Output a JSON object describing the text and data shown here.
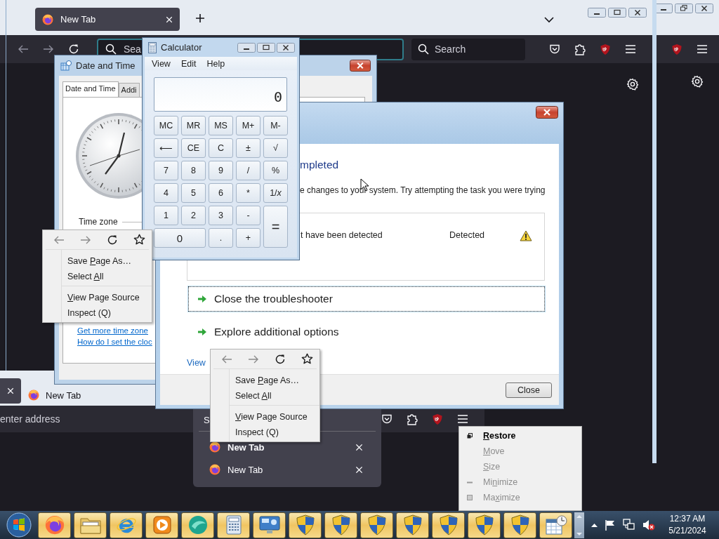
{
  "browser": {
    "tabs": [
      {
        "title": "New Tab",
        "selected": true
      }
    ],
    "address_placeholder": "Sea",
    "search_placeholder": "Search"
  },
  "lower_browser": {
    "tabs": [
      {
        "selected": true
      },
      {
        "title": "New Tab",
        "selected": false
      }
    ],
    "address_placeholder": "enter address"
  },
  "date_time_window": {
    "title": "Date and Time",
    "tabs": [
      {
        "label": "Date and Time",
        "selected": true
      },
      {
        "label": "Addi",
        "selected": false
      }
    ],
    "time_zone_label": "Time zone",
    "links": [
      "Get more time zone",
      "How do I set the cloc"
    ]
  },
  "troubleshooter": {
    "heading": "mpleted",
    "message": "e changes to your system. Try attempting the task you were trying",
    "results": [
      {
        "problem": "t have been detected",
        "status": "Detected"
      }
    ],
    "options": [
      {
        "label": "Close the troubleshooter",
        "focused": true
      },
      {
        "label": "Explore additional options",
        "focused": false
      }
    ],
    "details_link": "View",
    "close_button": "Close"
  },
  "calculator": {
    "title": "Calculator",
    "menu": [
      "View",
      "Edit",
      "Help"
    ],
    "display": "0",
    "keys": [
      {
        "label": "MC",
        "kind": "normal"
      },
      {
        "label": "MR",
        "kind": "normal"
      },
      {
        "label": "MS",
        "kind": "normal"
      },
      {
        "label": "M+",
        "kind": "normal"
      },
      {
        "label": "M-",
        "kind": "normal"
      },
      {
        "label": "⟵",
        "kind": "normal"
      },
      {
        "label": "CE",
        "kind": "normal"
      },
      {
        "label": "C",
        "kind": "normal"
      },
      {
        "label": "±",
        "kind": "normal"
      },
      {
        "label": "√",
        "kind": "normal"
      },
      {
        "label": "7",
        "kind": "normal"
      },
      {
        "label": "8",
        "kind": "normal"
      },
      {
        "label": "9",
        "kind": "normal"
      },
      {
        "label": "/",
        "kind": "normal"
      },
      {
        "label": "%",
        "kind": "normal"
      },
      {
        "label": "4",
        "kind": "normal"
      },
      {
        "label": "5",
        "kind": "normal"
      },
      {
        "label": "6",
        "kind": "normal"
      },
      {
        "label": "*",
        "kind": "normal"
      },
      {
        "label": "1/*x*",
        "kind": "normal"
      },
      {
        "label": "1",
        "kind": "normal"
      },
      {
        "label": "2",
        "kind": "normal"
      },
      {
        "label": "3",
        "kind": "normal"
      },
      {
        "label": "-",
        "kind": "normal"
      },
      {
        "label": "=",
        "kind": "tall"
      },
      {
        "label": "0",
        "kind": "wide"
      },
      {
        "label": ".",
        "kind": "normal"
      },
      {
        "label": "+",
        "kind": "normal"
      }
    ]
  },
  "tab_list_panel": {
    "search": "S",
    "tabs": [
      {
        "title": "New Tab",
        "selected": true
      },
      {
        "title": "New Tab",
        "selected": false
      }
    ]
  },
  "context_menus": [
    {
      "groups": [
        [
          {
            "pre": "Save ",
            "key": "P",
            "post": "age As…"
          },
          {
            "pre": "Select ",
            "key": "A",
            "post": "ll"
          }
        ],
        [
          {
            "key": "V",
            "post": "iew Page Source"
          },
          {
            "pre": "Inspect (Q)"
          }
        ]
      ]
    },
    {
      "groups": [
        [
          {
            "pre": "Save ",
            "key": "P",
            "post": "age As…"
          },
          {
            "pre": "Select ",
            "key": "A",
            "post": "ll"
          }
        ],
        [
          {
            "key": "V",
            "post": "iew Page Source"
          },
          {
            "pre": "Inspect (Q)"
          }
        ]
      ]
    }
  ],
  "system_menu": {
    "items": [
      {
        "key": "R",
        "post": "estore",
        "default": true,
        "disabled": false,
        "kind": "restore"
      },
      {
        "key": "M",
        "post": "ove",
        "default": false,
        "disabled": true,
        "kind": "none"
      },
      {
        "key": "S",
        "post": "ize",
        "default": false,
        "disabled": true,
        "kind": "none"
      },
      {
        "pre": "Mi",
        "key": "n",
        "post": "imize",
        "default": false,
        "disabled": true,
        "kind": "minimize"
      },
      {
        "pre": "Ma",
        "key": "x",
        "post": "imize",
        "default": false,
        "disabled": true,
        "kind": "maximize"
      }
    ]
  },
  "taskbar": {
    "clock_time": "12:37 AM",
    "clock_date": "5/21/2024"
  }
}
